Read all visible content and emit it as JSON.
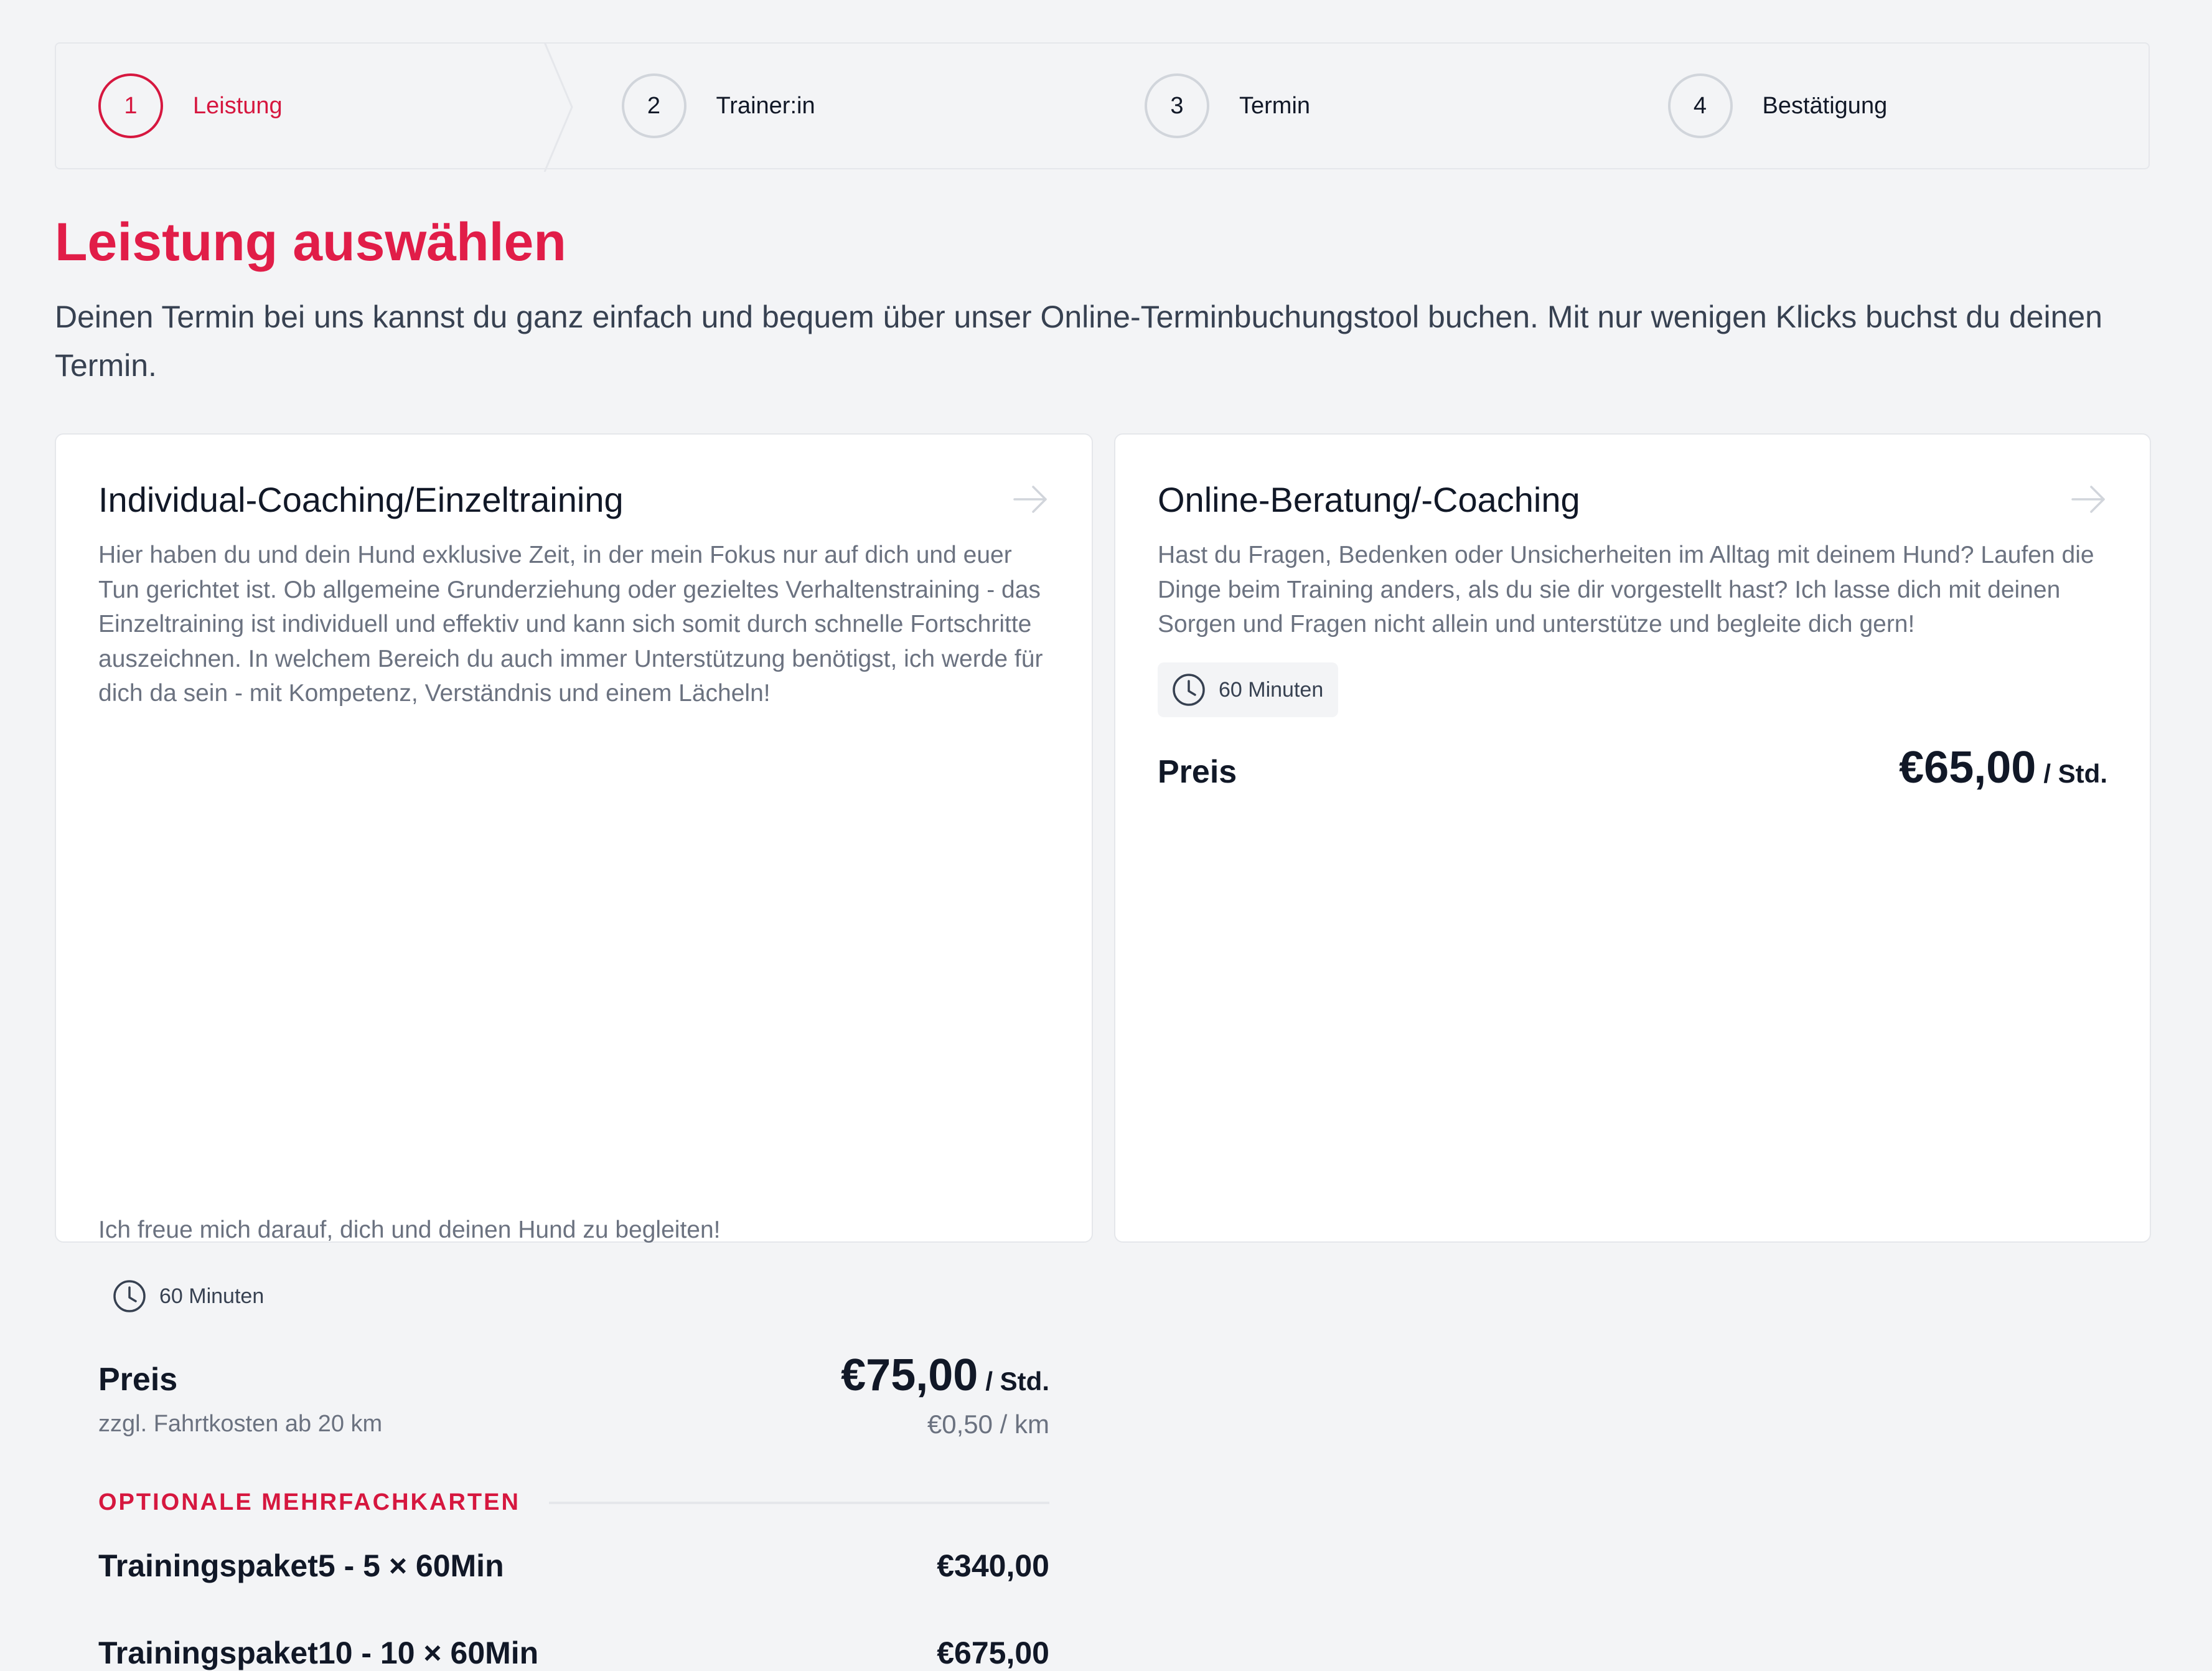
{
  "stepper": {
    "steps": [
      {
        "number": "1",
        "label": "Leistung",
        "active": true
      },
      {
        "number": "2",
        "label": "Trainer:in",
        "active": false
      },
      {
        "number": "3",
        "label": "Termin",
        "active": false
      },
      {
        "number": "4",
        "label": "Bestätigung",
        "active": false
      }
    ]
  },
  "page": {
    "title": "Leistung auswählen",
    "intro": "Deinen Termin bei uns kannst du ganz einfach und bequem über unser Online-Terminbuchungstool buchen. Mit nur wenigen Klicks buchst du deinen Termin."
  },
  "services": [
    {
      "title": "Individual-Coaching/Einzeltraining",
      "description": "Hier haben du und dein Hund exklusive Zeit, in der mein Fokus nur auf dich und euer Tun gerichtet ist. Ob allgemeine Grunderziehung oder gezieltes Verhaltenstraining - das Einzeltraining ist individuell und effektiv und kann sich somit durch schnelle Fortschritte auszeichnen. In welchem Bereich du auch immer Unterstützung benötigst, ich werde für dich da sein - mit Kompetenz, Verständnis und einem Lächeln!",
      "description2": "Ich freue mich darauf, dich und deinen Hund zu begleiten!",
      "duration": "60 Minuten",
      "price_label": "Preis",
      "price": "€75,00",
      "price_unit": "/ Std.",
      "extra_label": "zzgl. Fahrtkosten ab 20 km",
      "extra_price": "€0,50 / km",
      "packages_heading": "OPTIONALE MEHRFACHKARTEN",
      "packages": [
        {
          "name": "Trainingspaket5 - 5 × 60Min",
          "price": "€340,00"
        },
        {
          "name": "Trainingspaket10 - 10 × 60Min",
          "price": "€675,00"
        }
      ]
    },
    {
      "title": "Online-Beratung/-Coaching",
      "description": "Hast du Fragen, Bedenken oder Unsicherheiten im Alltag mit deinem Hund? Laufen die Dinge beim Training anders, als du sie dir vorgestellt hast? Ich lasse dich mit deinen Sorgen und Fragen nicht allein und unterstütze und begleite dich gern!",
      "duration": "60 Minuten",
      "price_label": "Preis",
      "price": "€65,00",
      "price_unit": "/ Std."
    }
  ],
  "colors": {
    "accent": "#e11d48",
    "accent_dark": "#d6173f",
    "background": "#f3f4f6",
    "text": "#111827",
    "muted": "#6b7280"
  },
  "icons": {
    "arrow": "arrow-right-icon",
    "clock": "clock-icon"
  }
}
